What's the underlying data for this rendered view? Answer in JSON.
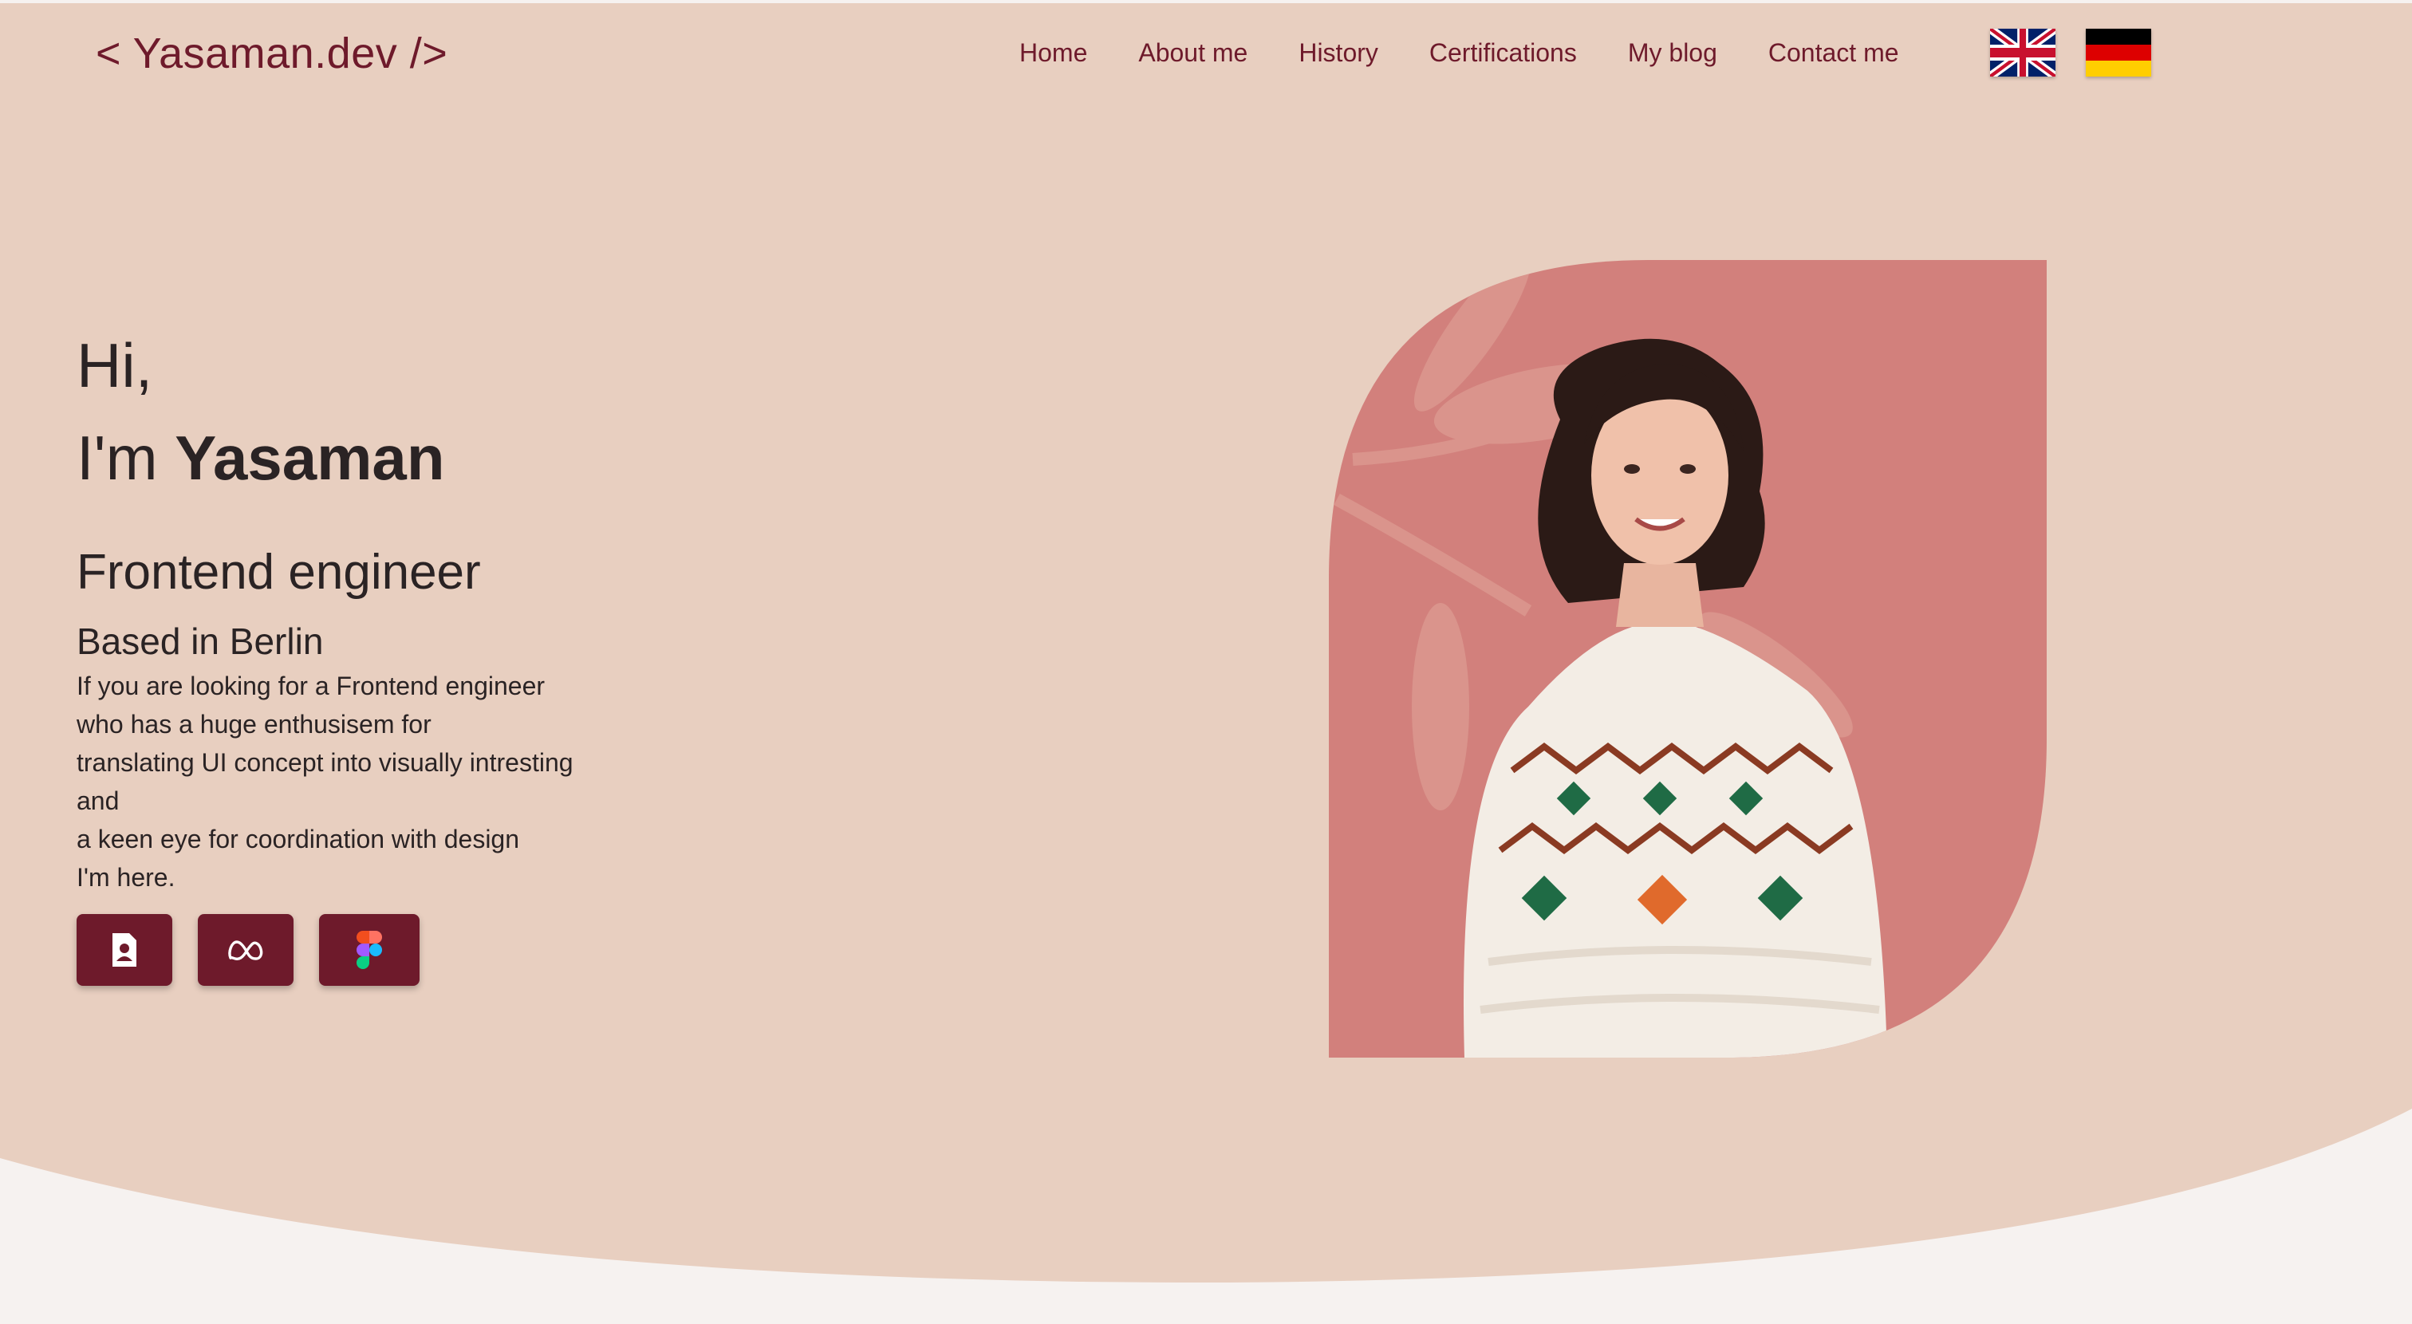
{
  "header": {
    "logo": "< Yasaman.dev />",
    "nav": [
      {
        "label": "Home"
      },
      {
        "label": "About me"
      },
      {
        "label": "History"
      },
      {
        "label": "Certifications"
      },
      {
        "label": "My blog"
      },
      {
        "label": "Contact me"
      }
    ],
    "languages": [
      {
        "icon": "uk-flag-icon"
      },
      {
        "icon": "germany-flag-icon"
      }
    ]
  },
  "hero": {
    "greeting": "Hi,",
    "intro_prefix": "I'm ",
    "name": "Yasaman",
    "role": "Frontend engineer",
    "location": "Based in Berlin",
    "description_lines": [
      "If you are looking for a Frontend engineer",
      "who has a huge enthusisem for",
      "translating UI concept into visually intresting",
      "and",
      "a keen eye for coordination with design"
    ],
    "closing": "I'm here."
  },
  "social_buttons": [
    {
      "icon": "resume-icon"
    },
    {
      "icon": "meta-icon"
    },
    {
      "icon": "figma-icon"
    }
  ],
  "colors": {
    "background": "#e8cfc0",
    "accent": "#6e1a2b",
    "portrait_shape": "#d2807c",
    "footer_band": "#f6f2f0",
    "text": "#2a2324"
  }
}
